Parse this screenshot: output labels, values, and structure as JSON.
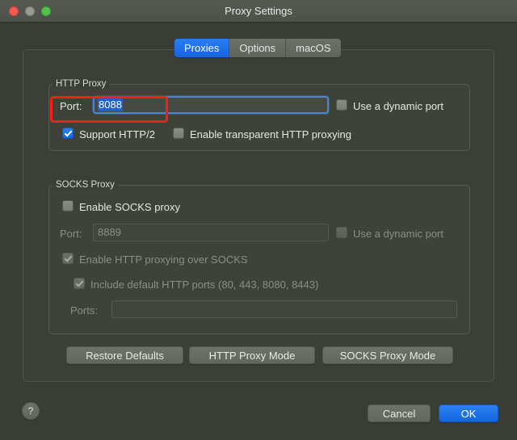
{
  "window": {
    "title": "Proxy Settings",
    "traffic_lights": [
      {
        "name": "close",
        "color": "#f5584c"
      },
      {
        "name": "minimize",
        "color": "#9a9a95"
      },
      {
        "name": "maximize",
        "color": "#4ec44a"
      }
    ]
  },
  "tabs": [
    {
      "label": "Proxies",
      "active": true
    },
    {
      "label": "Options",
      "active": false
    },
    {
      "label": "macOS",
      "active": false
    }
  ],
  "http_proxy": {
    "group_label": "HTTP Proxy",
    "port_label": "Port:",
    "port_value": "8088",
    "port_placeholder": "",
    "dynamic_port_label": "Use a dynamic port",
    "dynamic_port_checked": false,
    "support_http2_label": "Support HTTP/2",
    "support_http2_checked": true,
    "transparent_label": "Enable transparent HTTP proxying",
    "transparent_checked": false
  },
  "socks_proxy": {
    "group_label": "SOCKS Proxy",
    "enable_label": "Enable SOCKS proxy",
    "enable_checked": false,
    "port_label": "Port:",
    "port_value": "8889",
    "dynamic_port_label": "Use a dynamic port",
    "dynamic_port_checked": false,
    "http_over_socks_label": "Enable HTTP proxying over SOCKS",
    "http_over_socks_checked": true,
    "default_ports_label": "Include default HTTP ports (80, 443, 8080, 8443)",
    "default_ports_checked": true,
    "ports_label": "Ports:",
    "ports_value": ""
  },
  "mode_buttons": {
    "restore_defaults": "Restore Defaults",
    "http_proxy_mode": "HTTP Proxy Mode",
    "socks_proxy_mode": "SOCKS Proxy Mode"
  },
  "footer": {
    "help": "?",
    "cancel": "Cancel",
    "ok": "OK"
  },
  "colors": {
    "accent_blue": "#1366e1",
    "highlight_red": "#fc1b1b",
    "window_bg": "#3a3d36",
    "panel_bg": "#3c3f38"
  }
}
